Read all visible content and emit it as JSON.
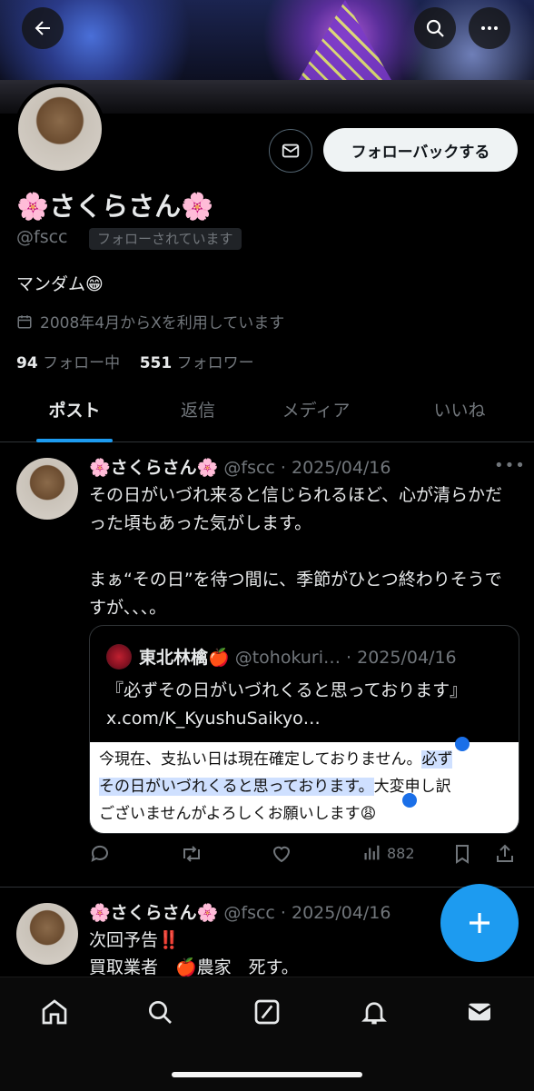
{
  "profile": {
    "name": "🌸さくらさん🌸",
    "handle": "@fscc",
    "follows_you": "フォローされています",
    "bio": "マンダム😁",
    "joined": "2008年4月からXを利用しています",
    "following_count": "94",
    "following_label": "フォロー中",
    "followers_count": "551",
    "followers_label": "フォロワー",
    "follow_button": "フォローバックする"
  },
  "tabs": [
    "ポスト",
    "返信",
    "メディア",
    "いいね"
  ],
  "posts": [
    {
      "name": "🌸さくらさん🌸",
      "meta": "@fscc · 2025/04/16",
      "text": "その日がいづれ来ると信じられるほど、心が清らかだった頃もあった気がします。\n\nまぁ“その日”を待つ間に、季節がひとつ終わりそうですが、、、。",
      "quote": {
        "name": "東北林檎🍎",
        "meta": "@tohokuri… · 2025/04/16",
        "text": "『必ずその日がいづれくると思っております』 x.com/K_KyushuSaikyo…",
        "image_text_plain1": "今現在、支払い日は現在確定しておりません。",
        "image_text_hl1": "必ず",
        "image_text_hl2": "その日がいづれくると思っております。",
        "image_text_plain2": "大変申し訳",
        "image_text_plain3": "ございませんがよろしくお願いします😩"
      },
      "views": "882"
    },
    {
      "name": "🌸さくらさん🌸",
      "meta": "@fscc · 2025/04/16",
      "text": "次回予告‼️\n買取業者　🍎農家　死す。"
    }
  ],
  "icons": {
    "back": "back-arrow-icon",
    "search": "search-icon",
    "more": "more-icon",
    "mail": "mail-icon",
    "calendar": "calendar-icon",
    "compose": "plus-icon"
  },
  "colors": {
    "accent": "#1d9bf0",
    "background": "#000000",
    "muted": "#71767b"
  }
}
